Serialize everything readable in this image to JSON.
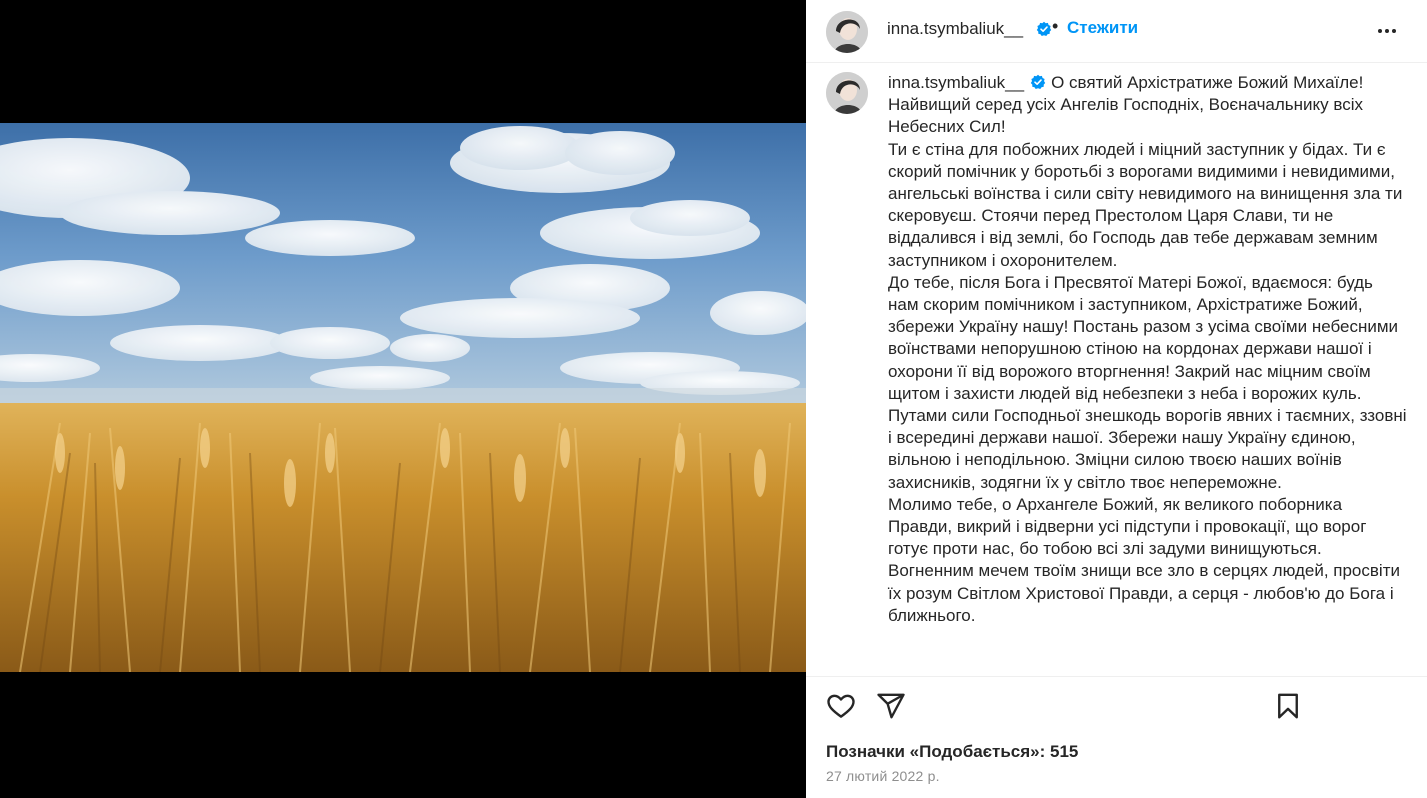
{
  "header": {
    "username": "inna.tsymbaliuk__",
    "separator": "•",
    "follow_label": "Стежити",
    "more_icon": "more-horizontal-icon"
  },
  "caption": {
    "username": "inna.tsymbaliuk__",
    "paragraphs": [
      "О святий Архістратиже Божий Михаїле! Найвищий серед усіх Ангелів Господніх, Воєначальнику всіх Небесних Сил!",
      "Ти є стіна для побожних людей і міцний заступник у бідах. Ти є скорий помічник у боротьбі з ворогами видимими і невидимими, ангельські воїнства і сили світу невидимого на винищення зла ти скеровуєш. Стоячи перед Престолом Царя Слави, ти не віддалився і від землі, бо Господь дав тебе державам земним заступником і охоронителем.",
      "До тебе, після Бога і Пресвятої Матері Божої, вдаємося: будь нам скорим помічником і заступником, Архістратиже Божий, збережи Україну нашу! Постань разом з усіма своїми небесними воїнствами непорушною стіною на кордонах держави нашої і охорони її від ворожого вторгнення! Закрий нас міцним своїм щитом і захисти людей від небезпеки з неба і ворожих куль. Путами сили Господньої знешкодь ворогів явних і таємних, ззовні і всередині держави нашої. Збережи нашу Україну єдиною, вільною і неподільною. Зміцни силою твоєю наших воїнів захисників, зодягни їх у світло твоє непереможне.",
      "Молимо тебе, о Архангеле Божий, як великого поборника Правди, викрий і відверни усі підступи і провокації, що ворог готує проти нас, бо тобою всі злі задуми винищуються. Вогненним мечем твоїм знищи все зло в серцях людей, просвіти їх розум Світлом Христової Правди, а серця - любов'ю до Бога і ближнього."
    ]
  },
  "actions": {
    "like_icon": "heart-icon",
    "share_icon": "paper-plane-icon",
    "save_icon": "bookmark-icon"
  },
  "likes_text": "Позначки «Подобається»: 515",
  "date_text": "27 лютий 2022 р.",
  "colors": {
    "accent": "#0095f6",
    "verified": "#0095f6",
    "text": "#262626",
    "muted": "#8e8e8e",
    "media_background": "#000000"
  }
}
